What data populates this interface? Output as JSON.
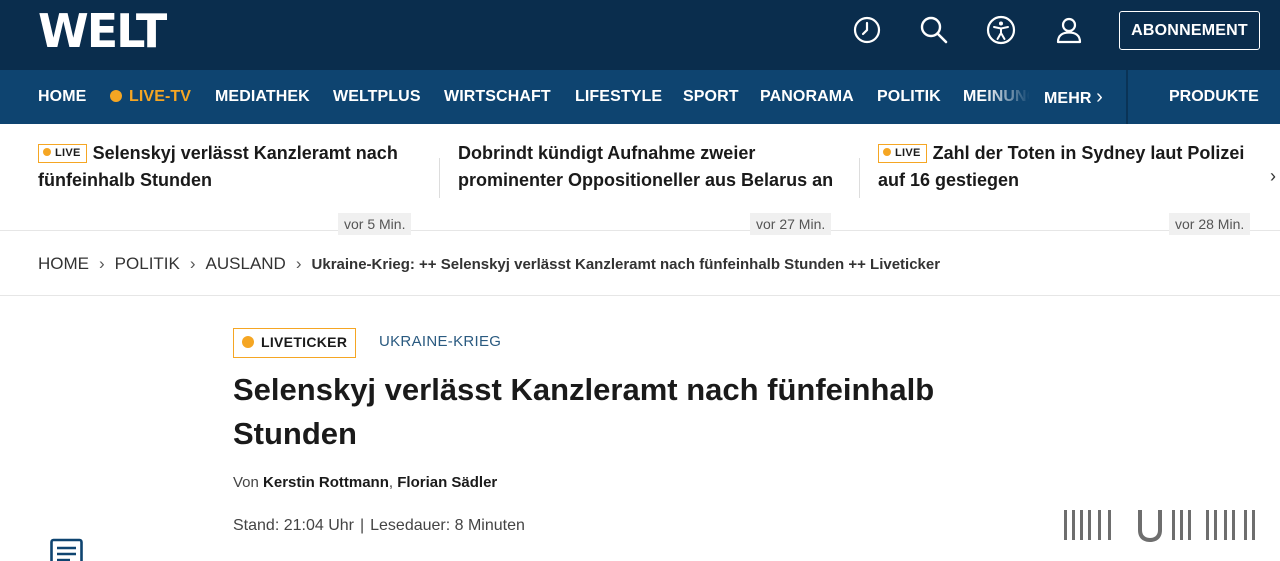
{
  "header": {
    "logo": "WELT",
    "subscribe_label": "ABONNEMENT",
    "icons": [
      "clock-icon",
      "search-icon",
      "accessibility-icon",
      "user-icon"
    ]
  },
  "nav": {
    "items": [
      {
        "label": "HOME"
      },
      {
        "label": "LIVE-TV"
      },
      {
        "label": "MEDIATHEK"
      },
      {
        "label": "WELTPLUS"
      },
      {
        "label": "WIRTSCHAFT"
      },
      {
        "label": "LIFESTYLE"
      },
      {
        "label": "SPORT"
      },
      {
        "label": "PANORAMA"
      },
      {
        "label": "POLITIK"
      },
      {
        "label": "MEINUNG"
      },
      {
        "label": "MEHR"
      }
    ],
    "more_chevron": "›",
    "produkte": "PRODUKTE"
  },
  "teasers": [
    {
      "badge": "LIVE",
      "title": "Selenskyj verlässt Kanzleramt nach fünfeinhalb Stunden",
      "time": "vor 5 Min."
    },
    {
      "badge": "",
      "title": "Dobrindt kündigt Aufnahme zweier prominenter Oppositioneller aus Belarus an",
      "time": "vor 27 Min."
    },
    {
      "badge": "LIVE",
      "title": "Zahl der Toten in Sydney laut Polizei auf 16 gestiegen",
      "time": "vor 28 Min."
    }
  ],
  "breadcrumb": {
    "items": [
      "HOME",
      "POLITIK",
      "AUSLAND"
    ],
    "current": "Ukraine-Krieg: ++ Selenskyj verlässt Kanzleramt nach fünfeinhalb Stunden ++ Liveticker"
  },
  "article": {
    "kicker": "LIVETICKER",
    "topic": "UKRAINE-KRIEG",
    "headline": "Selenskyj verlässt Kanzleramt nach fünfeinhalb Stunden",
    "by_prefix": "Von",
    "authors": [
      "Kerstin Rottmann",
      "Florian Sädler"
    ],
    "stand": "Stand: 21:04 Uhr",
    "reading_time": "Lesedauer: 8 Minuten"
  },
  "colors": {
    "header_bg": "#0a2d4d",
    "nav_bg": "#0e4470",
    "accent_live": "#f5a623",
    "topic_link": "#2a5a80"
  }
}
